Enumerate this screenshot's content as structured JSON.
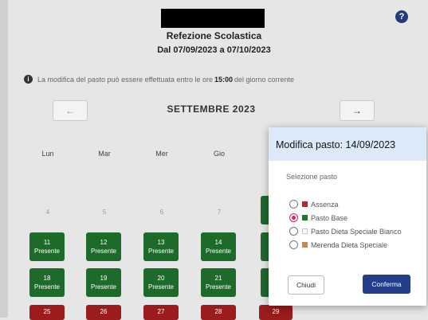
{
  "header": {
    "title": "Refezione Scolastica",
    "date_range": "Dal 07/09/2023 a 07/10/2023",
    "help_glyph": "?"
  },
  "info": {
    "text_before": "La modifica del pasto può essere effettuata entro le ore",
    "time": "15:00",
    "text_after": "del giorno corrente"
  },
  "calendar": {
    "month_label": "SETTEMBRE 2023",
    "prev_glyph": "←",
    "next_glyph": "→",
    "weekdays": [
      "Lun",
      "Mar",
      "Mer",
      "Gio"
    ],
    "week1_dates": [
      "4",
      "5",
      "6",
      "7"
    ],
    "week2": [
      {
        "day": "11",
        "status": "Presente"
      },
      {
        "day": "12",
        "status": "Presente"
      },
      {
        "day": "13",
        "status": "Presente"
      },
      {
        "day": "14",
        "status": "Presente"
      }
    ],
    "week3": [
      {
        "day": "18",
        "status": "Presente"
      },
      {
        "day": "19",
        "status": "Presente"
      },
      {
        "day": "20",
        "status": "Presente"
      },
      {
        "day": "21",
        "status": "Presente"
      }
    ],
    "week4_dates": [
      "25",
      "26",
      "27",
      "28",
      "29"
    ],
    "colors": {
      "present": "#1d6a2b",
      "absent": "#9a1c1c"
    }
  },
  "modal": {
    "title": "Modifica pasto: 14/09/2023",
    "section_label": "Selezione pasto",
    "options": [
      {
        "label": "Assenza",
        "color": "#cc1f1f",
        "checked": false
      },
      {
        "label": "Pasto Base",
        "color": "#1d7a2c",
        "checked": true
      },
      {
        "label": "Pasto Dieta Speciale Bianco",
        "color": "#e8d23a",
        "checked": false
      },
      {
        "label": "Merenda Dieta Speciale",
        "color": "#c9874a",
        "checked": false
      }
    ],
    "close_label": "Chiudi",
    "confirm_label": "Conferma"
  }
}
